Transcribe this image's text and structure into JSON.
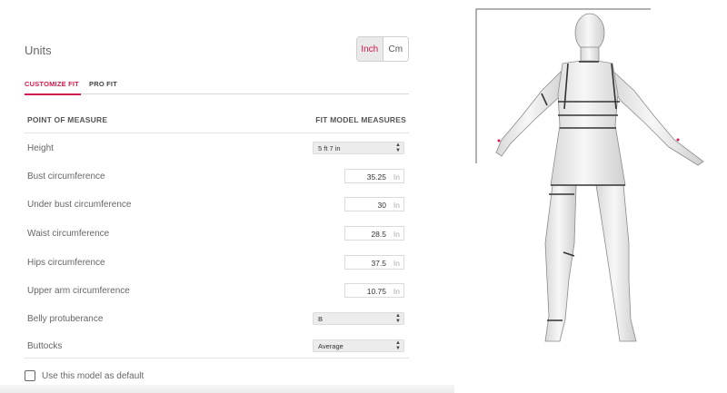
{
  "units": {
    "label": "Units",
    "options": [
      "Inch",
      "Cm"
    ],
    "selected": "Inch"
  },
  "tabs": [
    {
      "label": "CUSTOMIZE FIT",
      "active": true
    },
    {
      "label": "PRO FIT",
      "active": false
    }
  ],
  "table": {
    "col_left": "POINT OF MEASURE",
    "col_right": "FIT MODEL MEASURES"
  },
  "rows": [
    {
      "label": "Height",
      "type": "select",
      "value": "5 ft 7 in"
    },
    {
      "label": "Bust circumference",
      "type": "number",
      "value": "35.25",
      "unit": "In"
    },
    {
      "label": "Under bust circumference",
      "type": "number",
      "value": "30",
      "unit": "In"
    },
    {
      "label": "Waist circumference",
      "type": "number",
      "value": "28.5",
      "unit": "In"
    },
    {
      "label": "Hips circumference",
      "type": "number",
      "value": "37.5",
      "unit": "In"
    },
    {
      "label": "Upper arm circumference",
      "type": "number",
      "value": "10.75",
      "unit": "In"
    },
    {
      "label": "Belly protuberance",
      "type": "select",
      "value": "B"
    },
    {
      "label": "Buttocks",
      "type": "select",
      "value": "Average"
    }
  ],
  "default_checkbox": {
    "label": "Use this model as default",
    "checked": false
  },
  "colors": {
    "accent": "#d51a4d",
    "measure_lines": "#333333"
  }
}
